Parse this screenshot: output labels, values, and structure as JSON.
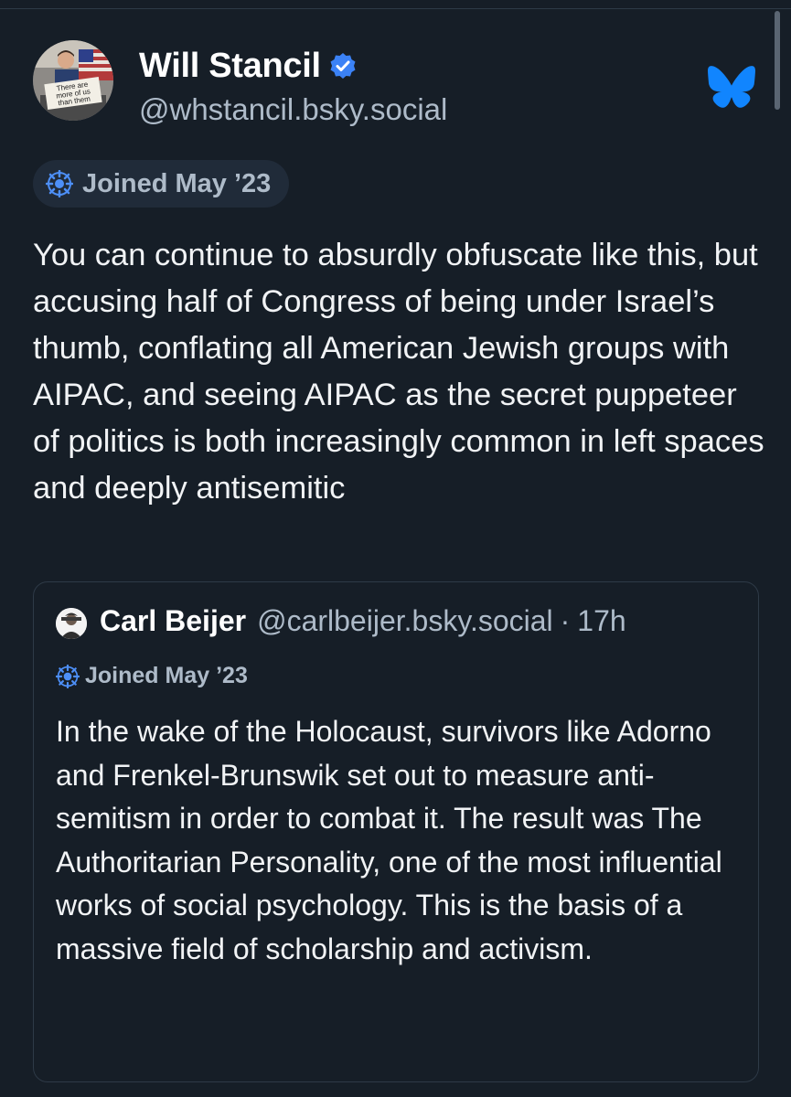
{
  "author": {
    "display_name": "Will Stancil",
    "handle": "@whstancil.bsky.social",
    "avatar_sign_text": "There are more of us than them",
    "joined": "Joined May ’23"
  },
  "post": {
    "text": "You can continue to absurdly obfuscate like this, but accusing half of Congress of being under Israel’s thumb, conflating all American Jewish groups with AIPAC, and seeing AIPAC as the secret puppeteer of politics is both increasingly common in left spaces and deeply antisemitic"
  },
  "quote": {
    "display_name": "Carl Beijer",
    "handle": "@carlbeijer.bsky.social",
    "separator": "·",
    "time": "17h",
    "joined": "Joined May ’23",
    "text": "In the wake of the Holocaust, survivors like Adorno and Frenkel-Brunswik set out to measure anti-semitism in order to combat it. The result was The Authoritarian Personality, one of the most influential works of social psychology. This is the basis of a massive field of scholarship and activism."
  },
  "colors": {
    "background": "#161e27",
    "pill_background": "#202b39",
    "secondary_text": "#aebbc9",
    "brand_blue": "#1185fe",
    "verified_blue": "#3b82f6"
  },
  "icons": {
    "verified": "verified-check-icon",
    "brand": "bluesky-butterfly-icon",
    "joined": "new-account-badge-icon"
  }
}
